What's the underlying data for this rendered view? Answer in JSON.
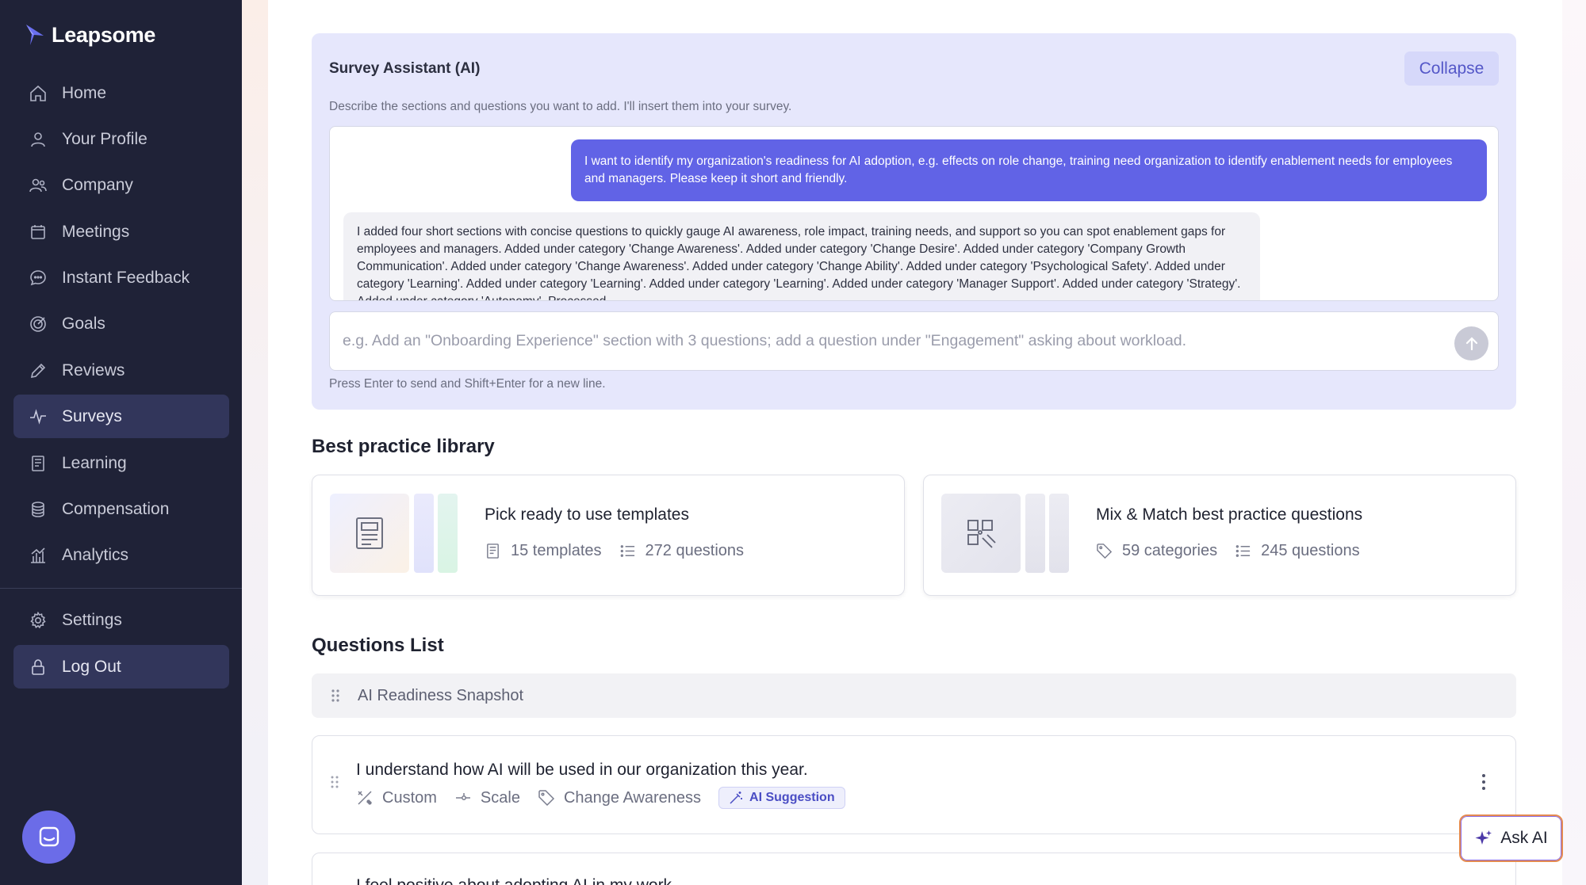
{
  "app": {
    "name": "Leapsome"
  },
  "sidebar": {
    "items": [
      {
        "label": "Home",
        "icon": "home-icon"
      },
      {
        "label": "Your Profile",
        "icon": "user-icon"
      },
      {
        "label": "Company",
        "icon": "users-icon"
      },
      {
        "label": "Meetings",
        "icon": "calendar-icon"
      },
      {
        "label": "Instant Feedback",
        "icon": "chat-icon"
      },
      {
        "label": "Goals",
        "icon": "target-icon"
      },
      {
        "label": "Reviews",
        "icon": "pencil-icon"
      },
      {
        "label": "Surveys",
        "icon": "pulse-icon",
        "active": true
      },
      {
        "label": "Learning",
        "icon": "book-icon"
      },
      {
        "label": "Compensation",
        "icon": "coins-icon"
      },
      {
        "label": "Analytics",
        "icon": "chart-icon"
      }
    ],
    "bottom_items": [
      {
        "label": "Settings",
        "icon": "gear-icon"
      },
      {
        "label": "Log Out",
        "icon": "lock-icon"
      }
    ]
  },
  "assistant": {
    "title": "Survey Assistant (AI)",
    "collapse_label": "Collapse",
    "description": "Describe the sections and questions you want to add. I'll insert them into your survey.",
    "user_message": "I want to identify my organization's readiness for AI adoption, e.g. effects on role change, training need organization to identify enablement needs for employees and managers. Please keep it short and friendly.",
    "ai_message": "I added four short sections with concise questions to quickly gauge AI awareness, role impact, training needs, and support so you can spot enablement gaps for employees and managers. Added under category 'Change Awareness'. Added under category 'Change Desire'. Added under category 'Company Growth Communication'. Added under category 'Change Awareness'. Added under category 'Change Ability'. Added under category 'Psychological Safety'. Added under category 'Learning'. Added under category 'Learning'. Added under category 'Learning'. Added under category 'Manager Support'. Added under category 'Strategy'. Added under category 'Autonomy'. Processed.",
    "input_value": "",
    "input_placeholder": "e.g. Add an \"Onboarding Experience\" section with 3 questions; add a question under \"Engagement\" asking about workload.",
    "hint": "Press Enter to send and Shift+Enter for a new line."
  },
  "library": {
    "title": "Best practice library",
    "cards": [
      {
        "title": "Pick ready to use templates",
        "meta1": "15 templates",
        "meta2": "272 questions"
      },
      {
        "title": "Mix & Match best practice questions",
        "meta1": "59 categories",
        "meta2": "245 questions"
      }
    ]
  },
  "questions": {
    "title": "Questions List",
    "section_name": "AI Readiness Snapshot",
    "items": [
      {
        "text": "I understand how AI will be used in our organization this year.",
        "type": "Custom",
        "format": "Scale",
        "category": "Change Awareness",
        "badge": "AI Suggestion"
      },
      {
        "text": "I feel positive about adopting AI in my work."
      }
    ]
  },
  "ask_ai": {
    "label": "Ask AI"
  },
  "colors": {
    "sidebar": "#1f2237",
    "accent": "#6163e6",
    "panel": "#e6e7fc"
  }
}
